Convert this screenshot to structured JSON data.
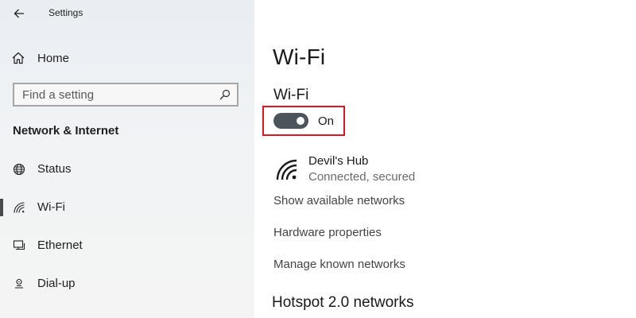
{
  "window": {
    "title": "Settings"
  },
  "sidebar": {
    "home_label": "Home",
    "search": {
      "placeholder": "Find a setting"
    },
    "section_title": "Network & Internet",
    "items": [
      {
        "label": "Status",
        "icon": "globe-icon"
      },
      {
        "label": "Wi-Fi",
        "icon": "wifi-icon",
        "active": true
      },
      {
        "label": "Ethernet",
        "icon": "ethernet-icon"
      },
      {
        "label": "Dial-up",
        "icon": "dialup-icon"
      }
    ]
  },
  "main": {
    "page_title": "Wi-Fi",
    "wifi_heading": "Wi-Fi",
    "toggle": {
      "state_label": "On",
      "on": true
    },
    "network": {
      "name": "Devil's Hub",
      "status": "Connected, secured"
    },
    "links": [
      "Show available networks",
      "Hardware properties",
      "Manage known networks"
    ],
    "hotspot_heading": "Hotspot 2.0 networks"
  },
  "colors": {
    "highlight_border": "#e0141e",
    "toggle_on": "#4d545c",
    "sidebar_bg": "#f1f3f5"
  }
}
